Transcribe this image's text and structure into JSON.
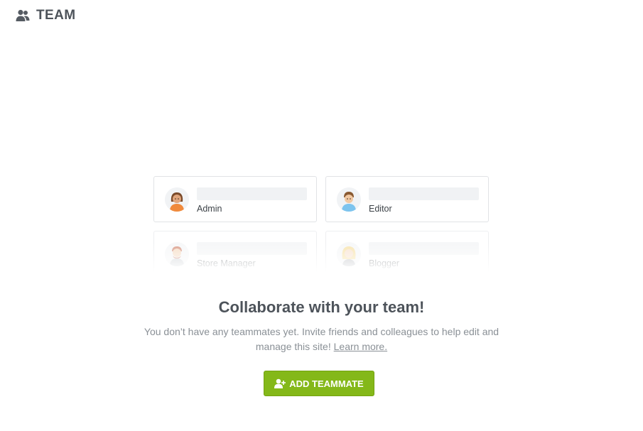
{
  "header": {
    "title": "TEAM",
    "icon": "team-icon"
  },
  "cards": [
    {
      "role": "Admin",
      "avatar": "admin-avatar"
    },
    {
      "role": "Editor",
      "avatar": "editor-avatar"
    },
    {
      "role": "Store Manager",
      "avatar": "store-manager-avatar"
    },
    {
      "role": "Blogger",
      "avatar": "blogger-avatar"
    }
  ],
  "empty_state": {
    "heading": "Collaborate with your team!",
    "description": "You don’t have any teammates yet. Invite friends and colleagues to help edit and manage this site!",
    "learn_more": "Learn more."
  },
  "add_button": {
    "label": "ADD TEAMMATE",
    "icon": "add-user-icon",
    "color": "#84b819"
  }
}
